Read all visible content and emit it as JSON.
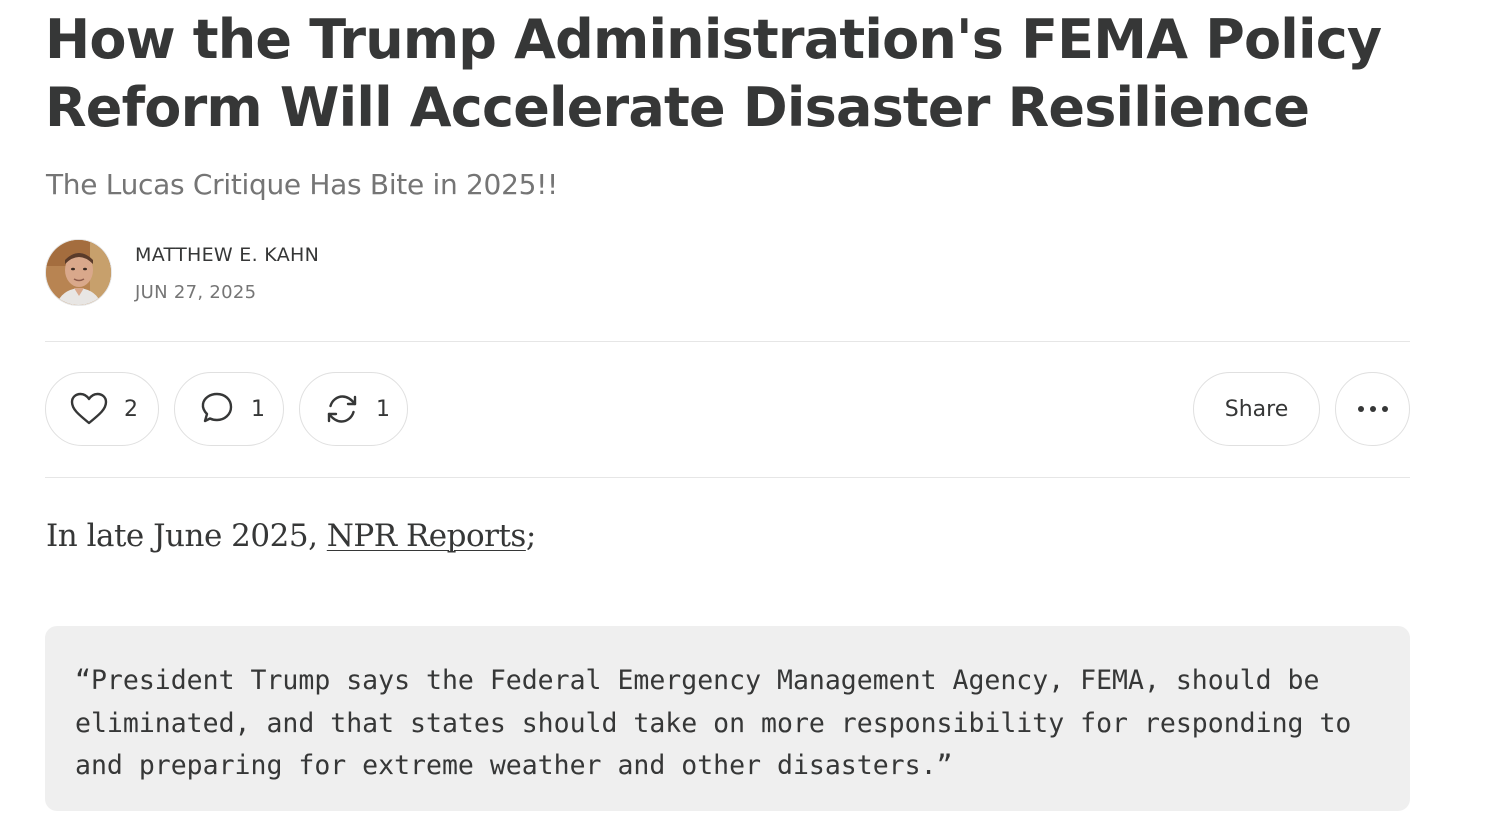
{
  "post": {
    "title": "How the Trump Administration's FEMA Policy Reform Will Accelerate Disaster Resilience",
    "subtitle": "The Lucas Critique Has Bite in 2025!!",
    "author": "MATTHEW E. KAHN",
    "date": "JUN 27, 2025"
  },
  "actions": {
    "likes": "2",
    "comments": "1",
    "restacks": "1",
    "share_label": "Share"
  },
  "body": {
    "intro_prefix": "In late June 2025, ",
    "intro_link": "NPR Reports",
    "intro_suffix": ";",
    "quote": "“President Trump says the Federal Emergency Management Agency, FEMA, should be eliminated, and that states should take on more responsibility for responding to and preparing for extreme weather and other disasters.”"
  },
  "icons": {
    "like": "heart-icon",
    "comment": "comment-bubble-icon",
    "restack": "restack-icon",
    "more": "more-horizontal-icon"
  }
}
